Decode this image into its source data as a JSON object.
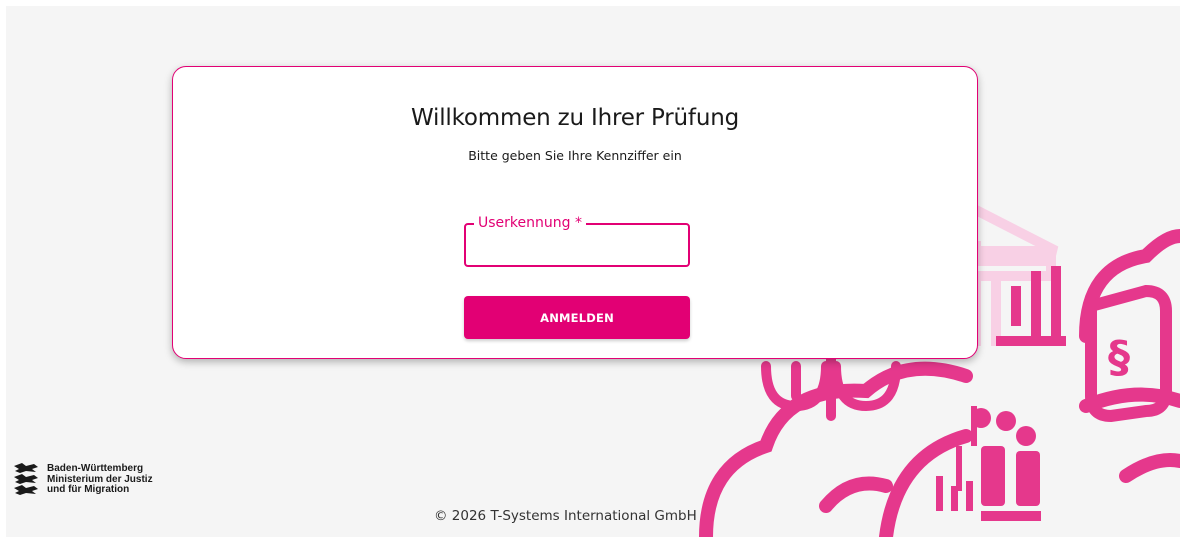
{
  "login": {
    "title": "Willkommen zu Ihrer Prüfung",
    "subtitle": "Bitte geben Sie Ihre Kennziffer ein",
    "field_label": "Userkennung *",
    "field_value": "",
    "submit_label": "ANMELDEN"
  },
  "logo": {
    "line1": "Baden-Württemberg",
    "line2": "Ministerium der Justiz",
    "line3": "und für Migration"
  },
  "footer": {
    "copyright": "© 2026 T-Systems International GmbH"
  },
  "colors": {
    "accent": "#e20074",
    "accent_light": "#f8d0e5",
    "background": "#f5f5f5"
  }
}
